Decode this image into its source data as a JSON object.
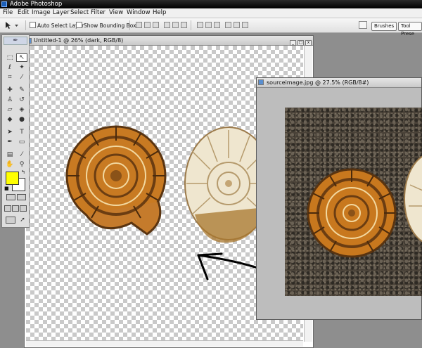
{
  "app": {
    "title": "Adobe Photoshop"
  },
  "menu": [
    "File",
    "Edit",
    "Image",
    "Layer",
    "Select",
    "Filter",
    "View",
    "Window",
    "Help"
  ],
  "options_bar": {
    "auto_select_label": "Auto Select Layer",
    "bounding_box_label": "Show Bounding Box",
    "palette_tabs": [
      "Brushes",
      "Tool Prese"
    ]
  },
  "toolbox": {
    "foreground_color": "#ffff00",
    "background_color": "#ffffff"
  },
  "documents": {
    "main": {
      "title": "Untitled-1 @ 26% (dark, RGB/8)"
    },
    "source": {
      "title": "sourceimage.jpg @ 27.5% (RGB/8#)"
    }
  },
  "colors": {
    "ammonite_orange": "#c8781e",
    "shell_cream": "#efe6cf",
    "title_bar": "#000000"
  }
}
